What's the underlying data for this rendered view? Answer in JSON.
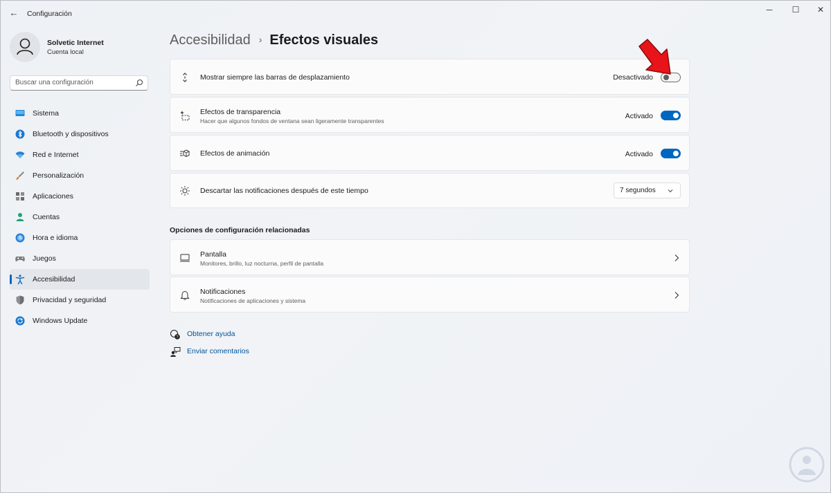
{
  "window": {
    "title": "Configuración",
    "back_icon": "back-arrow-icon",
    "controls": [
      "minimize-icon",
      "maximize-icon",
      "close-icon"
    ]
  },
  "profile": {
    "name": "Solvetic Internet",
    "account_type": "Cuenta local"
  },
  "search": {
    "placeholder": "Buscar una configuración"
  },
  "nav": {
    "items": [
      {
        "label": "Sistema",
        "icon": "system-icon"
      },
      {
        "label": "Bluetooth y dispositivos",
        "icon": "bluetooth-icon"
      },
      {
        "label": "Red e Internet",
        "icon": "wifi-icon"
      },
      {
        "label": "Personalización",
        "icon": "brush-icon"
      },
      {
        "label": "Aplicaciones",
        "icon": "apps-icon"
      },
      {
        "label": "Cuentas",
        "icon": "accounts-icon"
      },
      {
        "label": "Hora e idioma",
        "icon": "time-language-icon"
      },
      {
        "label": "Juegos",
        "icon": "gamepad-icon"
      },
      {
        "label": "Accesibilidad",
        "icon": "accessibility-icon"
      },
      {
        "label": "Privacidad y seguridad",
        "icon": "shield-icon"
      },
      {
        "label": "Windows Update",
        "icon": "update-icon"
      }
    ],
    "active": "Accesibilidad"
  },
  "breadcrumb": {
    "parent": "Accesibilidad",
    "separator": "›",
    "current": "Efectos visuales"
  },
  "settings": {
    "scrollbars": {
      "title": "Mostrar siempre las barras de desplazamiento",
      "state": "Desactivado",
      "on": false
    },
    "transparency": {
      "title": "Efectos de transparencia",
      "description": "Hacer que algunos fondos de ventana sean ligeramente transparentes",
      "state": "Activado",
      "on": true
    },
    "animation": {
      "title": "Efectos de animación",
      "state": "Activado",
      "on": true
    },
    "notifications": {
      "title": "Descartar las notificaciones después de este tiempo",
      "value": "7 segundos"
    }
  },
  "related": {
    "title": "Opciones de configuración relacionadas",
    "items": [
      {
        "title": "Pantalla",
        "description": "Monitores, brillo, luz nocturna, perfil de pantalla",
        "icon": "display-icon"
      },
      {
        "title": "Notificaciones",
        "description": "Notificaciones de aplicaciones y sistema",
        "icon": "bell-icon"
      }
    ]
  },
  "help": {
    "get_help": "Obtener ayuda",
    "feedback": "Enviar comentarios"
  },
  "colors": {
    "accent": "#0067c0",
    "link": "#00539a",
    "annotation_arrow": "#e8141a"
  }
}
